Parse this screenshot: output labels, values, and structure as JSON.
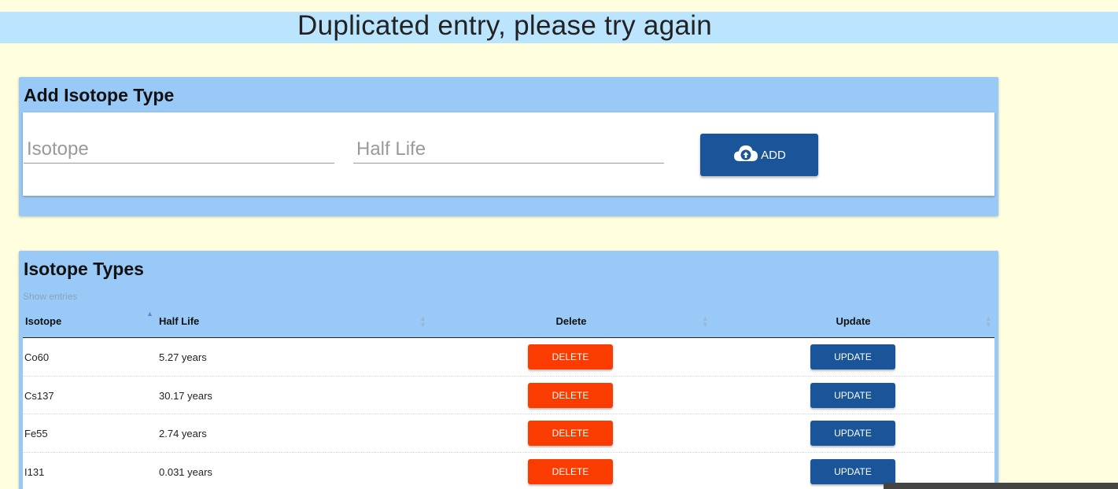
{
  "alert": {
    "message": "Duplicated entry, please try again"
  },
  "add_form": {
    "title": "Add Isotope Type",
    "isotope_placeholder": "Isotope",
    "isotope_value": "",
    "halflife_placeholder": "Half Life",
    "halflife_value": "",
    "add_label": "ADD",
    "add_icon": "cloud-upload-icon"
  },
  "list": {
    "title": "Isotope Types",
    "show_entries": "Show entries",
    "columns": [
      "Isotope",
      "Half Life",
      "Delete",
      "Update"
    ],
    "sort": {
      "column": "Isotope",
      "direction": "ascending"
    },
    "rows": [
      {
        "isotope": "Co60",
        "half_life": "5.27 years",
        "delete_label": "DELETE",
        "update_label": "UPDATE"
      },
      {
        "isotope": "Cs137",
        "half_life": "30.17 years",
        "delete_label": "DELETE",
        "update_label": "UPDATE"
      },
      {
        "isotope": "Fe55",
        "half_life": "2.74 years",
        "delete_label": "DELETE",
        "update_label": "UPDATE"
      },
      {
        "isotope": "I131",
        "half_life": "0.031 years",
        "delete_label": "DELETE",
        "update_label": "UPDATE"
      }
    ]
  },
  "colors": {
    "page_background": "#ffffdf",
    "alert_background": "#bbe5ff",
    "card_background": "#99c9f7",
    "primary_button": "#1a5499",
    "delete_button": "#fa3c00"
  }
}
